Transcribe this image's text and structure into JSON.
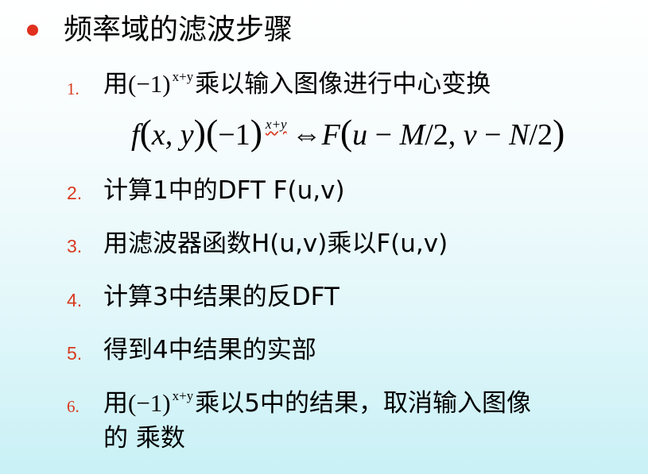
{
  "title": "频率域的滤波步骤",
  "steps": [
    {
      "num": "1.",
      "pre": "用",
      "expr": "(−1)",
      "sup": "x+y",
      "text": "乘以输入图像进行中心变换"
    },
    {
      "num": "2.",
      "text": "计算1中的DFT F(u,v)"
    },
    {
      "num": "3.",
      "text": "用滤波器函数H(u,v)乘以F(u,v)"
    },
    {
      "num": "4.",
      "text": "计算3中结果的反DFT"
    },
    {
      "num": "5.",
      "text": "得到4中结果的实部"
    },
    {
      "num": "6.",
      "pre": "用",
      "expr": "(−1)",
      "sup": "x+y",
      "text": "乘以5中的结果，取消输入图像",
      "text2": "的 乘数"
    }
  ],
  "formula": {
    "f": "f",
    "args": "x, y",
    "base": "−1",
    "exp": "x+y",
    "arrow": "⇔",
    "F": "F",
    "u": "u",
    "mid1": " − ",
    "M": "M",
    "div1": "/2, ",
    "v": "v",
    "mid2": " − ",
    "N": "N",
    "div2": "/2"
  }
}
